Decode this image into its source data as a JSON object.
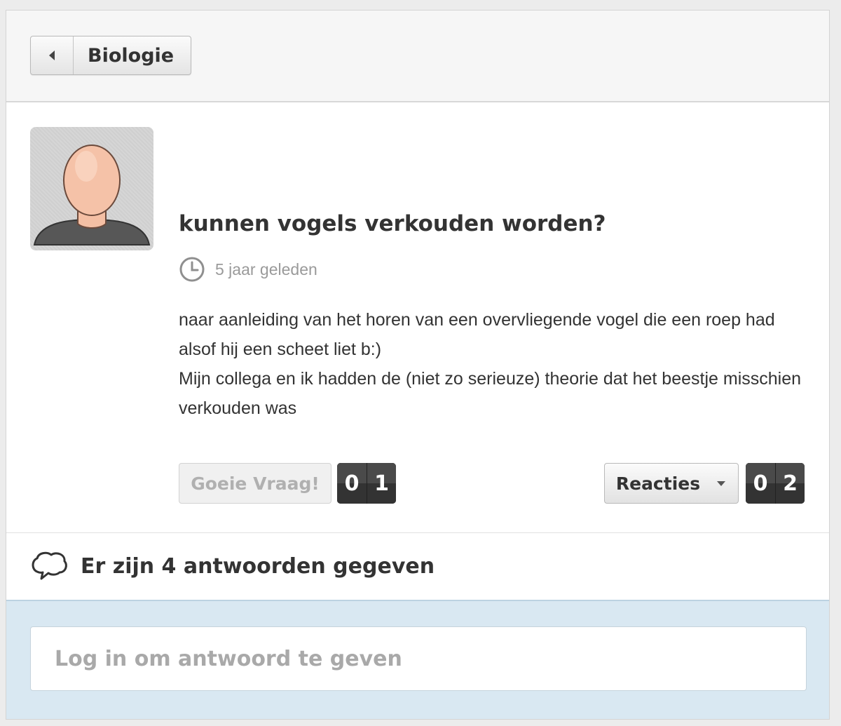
{
  "header": {
    "back_label": "Biologie"
  },
  "question": {
    "title": "kunnen vogels verkouden worden?",
    "timestamp": "5 jaar geleden",
    "body_lines": [
      "naar aanleiding van het horen van een overvliegende vogel die een roep had alsof hij een scheet liet b:)",
      "Mijn collega en ik hadden de (niet zo serieuze) theorie dat het beestje misschien verkouden was"
    ]
  },
  "actions": {
    "good_question_label": "Goeie Vraag!",
    "good_question_count": [
      "0",
      "1"
    ],
    "reacties_label": "Reacties",
    "reacties_count": [
      "0",
      "2"
    ]
  },
  "answers": {
    "summary": "Er zijn 4 antwoorden gegeven"
  },
  "login": {
    "placeholder": "Log in om antwoord te geven"
  },
  "colors": {
    "login_background": "#d9e8f2",
    "counter_background": "#3a3a3a"
  }
}
